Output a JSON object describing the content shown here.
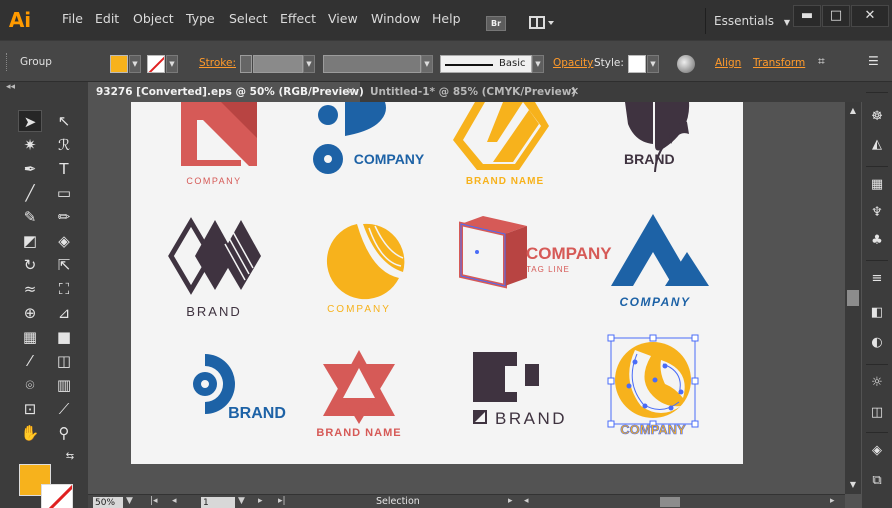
{
  "app": {
    "logo": "Ai",
    "menu": [
      "File",
      "Edit",
      "Object",
      "Type",
      "Select",
      "Effect",
      "View",
      "Window",
      "Help"
    ],
    "bridge_label": "Br",
    "workspace": "Essentials",
    "window_buttons": {
      "minimize": "▬",
      "restore": "□",
      "close": "✕"
    }
  },
  "control": {
    "selection_type": "Group",
    "fill_color": "#f7b21c",
    "stroke_label": "Stroke:",
    "brush_label": "Basic",
    "opacity_label": "Opacity",
    "style_label": "Style:",
    "align_label": "Align",
    "transform_label": "Transform"
  },
  "tabs": [
    {
      "label": "93276 [Converted].eps @ 50% (RGB/Preview)",
      "active": true
    },
    {
      "label": "Untitled-1* @ 85% (CMYK/Preview)",
      "active": false
    }
  ],
  "tools": [
    "selection-icon",
    "direct-selection-icon",
    "magic-wand-icon",
    "lasso-icon",
    "pen-icon",
    "type-icon",
    "line-icon",
    "rectangle-icon",
    "paintbrush-icon",
    "pencil-icon",
    "blob-brush-icon",
    "eraser-icon",
    "rotate-icon",
    "scale-icon",
    "width-icon",
    "free-transform-icon",
    "shape-builder-icon",
    "perspective-icon",
    "mesh-icon",
    "gradient-icon",
    "eyedropper-icon",
    "blend-icon",
    "symbol-sprayer-icon",
    "graph-icon",
    "artboard-icon",
    "slice-icon",
    "hand-icon",
    "zoom-icon"
  ],
  "logos": [
    {
      "name": "COMPANY",
      "color": "#d65a57"
    },
    {
      "name": "COMPANY",
      "color": "#1d62a6"
    },
    {
      "name": "BRAND NAME",
      "color": "#f7b21c"
    },
    {
      "name": "BRAND",
      "color": "#3f3340"
    },
    {
      "name": "BRAND",
      "color": "#3f3340"
    },
    {
      "name": "COMPANY",
      "color": "#f7b21c"
    },
    {
      "name": "COMPANY",
      "tagline": "TAG LINE",
      "color": "#d65a57"
    },
    {
      "name": "COMPANY",
      "color": "#1d62a6"
    },
    {
      "name": "BRAND",
      "color": "#1d62a6"
    },
    {
      "name": "BRAND NAME",
      "color": "#d65a57"
    },
    {
      "name": "BRAND",
      "color": "#3f3340"
    },
    {
      "name": "COMPANY",
      "color": "#f7b21c",
      "selected": true
    }
  ],
  "status": {
    "zoom": "50%",
    "page": "1",
    "tool_name": "Selection"
  },
  "colors": {
    "coral": "#d65a57",
    "blue": "#1d62a6",
    "yellow": "#f7b21c",
    "plum": "#3f3340",
    "selection": "#4a6cf7"
  }
}
